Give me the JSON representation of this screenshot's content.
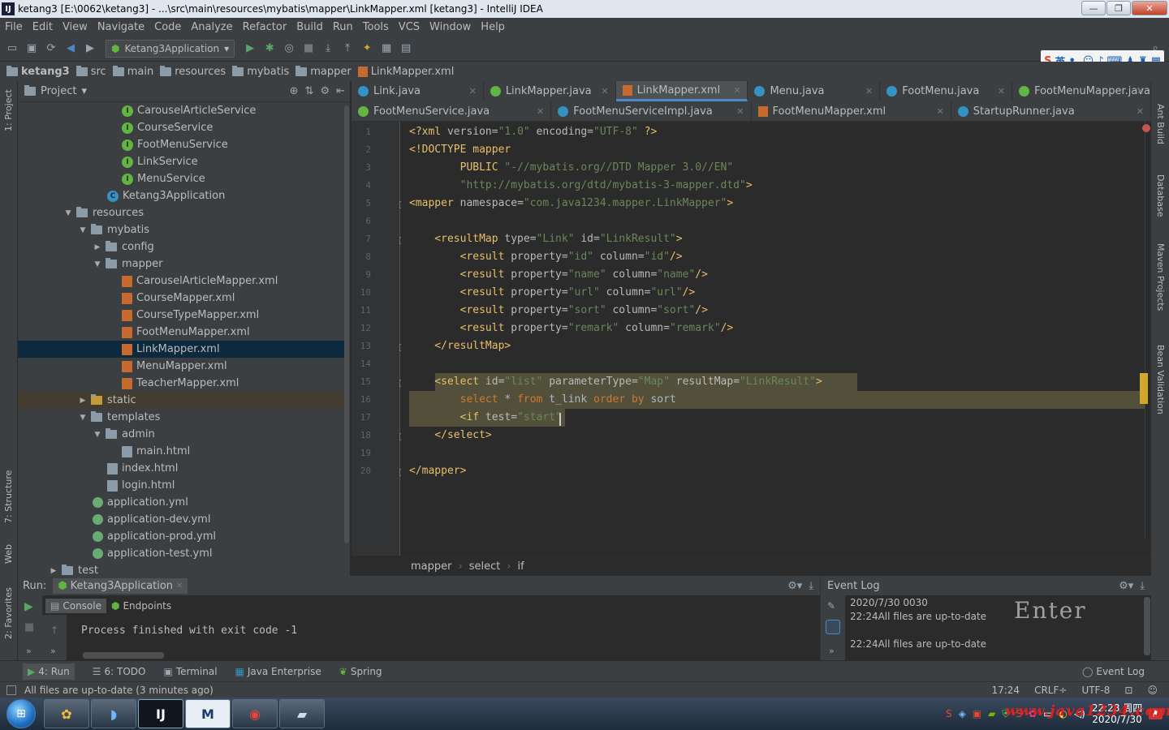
{
  "window": {
    "title": "ketang3 [E:\\0062\\ketang3] - ...\\src\\main\\resources\\mybatis\\mapper\\LinkMapper.xml [ketang3] - IntelliJ IDEA",
    "app_icon": "IJ"
  },
  "menu": [
    "File",
    "Edit",
    "View",
    "Navigate",
    "Code",
    "Analyze",
    "Refactor",
    "Build",
    "Run",
    "Tools",
    "VCS",
    "Window",
    "Help"
  ],
  "toolbar": {
    "run_config": "Ketang3Application"
  },
  "ime": {
    "label": "英"
  },
  "nav": [
    "ketang3",
    "src",
    "main",
    "resources",
    "mybatis",
    "mapper",
    "LinkMapper.xml"
  ],
  "left_strip": {
    "project": "1: Project",
    "structure": "7: Structure",
    "web": "Web",
    "favorites": "2: Favorites"
  },
  "right_strip": {
    "ant": "Ant Build",
    "database": "Database",
    "maven": "Maven Projects",
    "bean": "Bean Validation"
  },
  "project": {
    "title": "Project",
    "items": [
      {
        "label": "CarouselArticleService",
        "icon": "class-icon"
      },
      {
        "label": "CourseService",
        "icon": "class-icon"
      },
      {
        "label": "FootMenuService",
        "icon": "class-icon"
      },
      {
        "label": "LinkService",
        "icon": "class-icon"
      },
      {
        "label": "MenuService",
        "icon": "class-icon"
      },
      {
        "label": "Ketang3Application",
        "icon": "spring-class-icon"
      },
      {
        "label": "resources",
        "icon": "folder-icon"
      },
      {
        "label": "mybatis",
        "icon": "folder-icon"
      },
      {
        "label": "config",
        "icon": "folder-icon"
      },
      {
        "label": "mapper",
        "icon": "folder-icon"
      },
      {
        "label": "CarouselArticleMapper.xml",
        "icon": "xml-icon"
      },
      {
        "label": "CourseMapper.xml",
        "icon": "xml-icon"
      },
      {
        "label": "CourseTypeMapper.xml",
        "icon": "xml-icon"
      },
      {
        "label": "FootMenuMapper.xml",
        "icon": "xml-icon"
      },
      {
        "label": "LinkMapper.xml",
        "icon": "xml-icon"
      },
      {
        "label": "MenuMapper.xml",
        "icon": "xml-icon"
      },
      {
        "label": "TeacherMapper.xml",
        "icon": "xml-icon"
      },
      {
        "label": "static",
        "icon": "folder-icon"
      },
      {
        "label": "templates",
        "icon": "folder-icon"
      },
      {
        "label": "admin",
        "icon": "folder-icon"
      },
      {
        "label": "main.html",
        "icon": "html-icon"
      },
      {
        "label": "index.html",
        "icon": "html-icon"
      },
      {
        "label": "login.html",
        "icon": "html-icon"
      },
      {
        "label": "application.yml",
        "icon": "yml-icon"
      },
      {
        "label": "application-dev.yml",
        "icon": "yml-icon"
      },
      {
        "label": "application-prod.yml",
        "icon": "yml-icon"
      },
      {
        "label": "application-test.yml",
        "icon": "yml-icon"
      },
      {
        "label": "test",
        "icon": "folder-icon"
      }
    ]
  },
  "tabs_row1": [
    {
      "label": "Link.java",
      "icon": "class-icon"
    },
    {
      "label": "LinkMapper.java",
      "icon": "interface-icon"
    },
    {
      "label": "LinkMapper.xml",
      "icon": "xml-icon",
      "active": true
    },
    {
      "label": "Menu.java",
      "icon": "class-icon"
    },
    {
      "label": "FootMenu.java",
      "icon": "class-icon"
    },
    {
      "label": "FootMenuMapper.java",
      "icon": "interface-icon"
    }
  ],
  "tabs_row2": [
    {
      "label": "FootMenuService.java",
      "icon": "interface-icon"
    },
    {
      "label": "FootMenuServiceImpl.java",
      "icon": "class-icon"
    },
    {
      "label": "FootMenuMapper.xml",
      "icon": "xml-icon"
    },
    {
      "label": "StartupRunner.java",
      "icon": "class-icon"
    }
  ],
  "line_numbers": [
    "1",
    "2",
    "3",
    "4",
    "5",
    "6",
    "7",
    "8",
    "9",
    "10",
    "11",
    "12",
    "13",
    "14",
    "15",
    "16",
    "17",
    "18",
    "19",
    "20"
  ],
  "code": {
    "l1": {
      "a": "<?xml ",
      "b": "version=",
      "c": "\"1.0\"",
      "d": " encoding=",
      "e": "\"UTF-8\"",
      "f": " ?>"
    },
    "l2": "<!DOCTYPE mapper",
    "l3": {
      "a": "        PUBLIC ",
      "b": "\"-//mybatis.org//DTD Mapper 3.0//EN\""
    },
    "l4": {
      "a": "        ",
      "b": "\"http://mybatis.org/dtd/mybatis-3-mapper.dtd\"",
      "c": ">"
    },
    "l5": {
      "a": "<mapper ",
      "b": "namespace=",
      "c": "\"com.java1234.mapper.LinkMapper\"",
      "d": ">"
    },
    "l7": {
      "a": "    <resultMap ",
      "b": "type=",
      "c": "\"Link\"",
      "d": " id=",
      "e": "\"LinkResult\"",
      "f": ">"
    },
    "l8": {
      "a": "        <result ",
      "b": "property=",
      "c": "\"id\"",
      "d": " column=",
      "e": "\"id\"",
      "f": "/>"
    },
    "l9": {
      "a": "        <result ",
      "b": "property=",
      "c": "\"name\"",
      "d": " column=",
      "e": "\"name\"",
      "f": "/>"
    },
    "l10": {
      "a": "        <result ",
      "b": "property=",
      "c": "\"url\"",
      "d": " column=",
      "e": "\"url\"",
      "f": "/>"
    },
    "l11": {
      "a": "        <result ",
      "b": "property=",
      "c": "\"sort\"",
      "d": " column=",
      "e": "\"sort\"",
      "f": "/>"
    },
    "l12": {
      "a": "        <result ",
      "b": "property=",
      "c": "\"remark\"",
      "d": " column=",
      "e": "\"remark\"",
      "f": "/>"
    },
    "l13": "    </resultMap>",
    "l15": {
      "a": "    <select ",
      "b": "id=",
      "c": "\"list\"",
      "d": " parameterType=",
      "e": "\"Map\"",
      "f": " resultMap=",
      "g": "\"LinkResult\"",
      "h": ">"
    },
    "l16": {
      "a": "        ",
      "b": "select",
      "c": " * ",
      "d": "from",
      "e": " t_link ",
      "f": "order by",
      "g": " sort"
    },
    "l17": {
      "a": "        <if ",
      "b": "test=",
      "c": "\"start\""
    },
    "l18": "    </select>",
    "l20": "</mapper>"
  },
  "breadcrumbs": [
    "mapper",
    "select",
    "if"
  ],
  "run": {
    "label": "Run:",
    "config": "Ketang3Application",
    "tab_console": "Console",
    "tab_endpoints": "Endpoints",
    "output": "Process finished with exit code -1"
  },
  "event_log": {
    "title": "Event Log",
    "line1": "2020/7/30 0030",
    "line2": "22:24All files are up-to-date",
    "line3": "22:24All files are up-to-date",
    "overlay": "Enter"
  },
  "bottom_tabs": [
    "4: Run",
    "6: TODO",
    "Terminal",
    "Java Enterprise",
    "Spring"
  ],
  "bottom_right": "Event Log",
  "status": {
    "message": "All files are up-to-date (3 minutes ago)",
    "position": "17:24",
    "line_sep": "CRLF÷",
    "encoding": "UTF-8"
  },
  "clock": {
    "time": "22:28 周四",
    "date": "2020/7/30"
  },
  "watermark": "www.java1234.com"
}
